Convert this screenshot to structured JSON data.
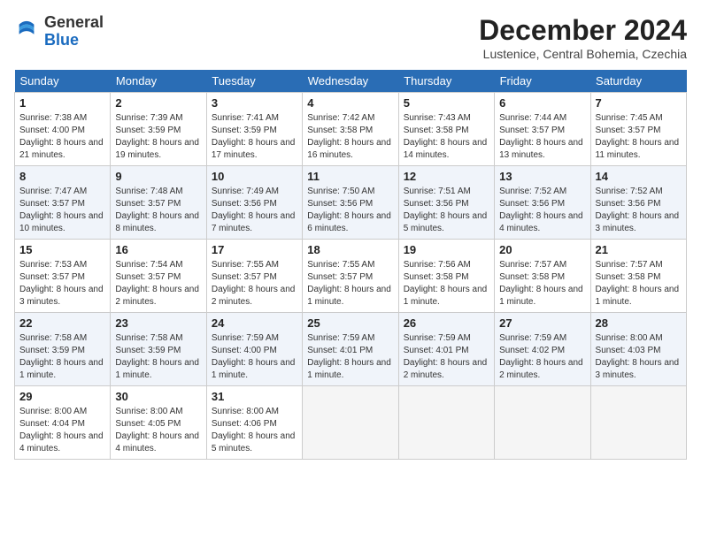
{
  "logo": {
    "general": "General",
    "blue": "Blue"
  },
  "title": "December 2024",
  "location": "Lustenice, Central Bohemia, Czechia",
  "days_of_week": [
    "Sunday",
    "Monday",
    "Tuesday",
    "Wednesday",
    "Thursday",
    "Friday",
    "Saturday"
  ],
  "weeks": [
    [
      {
        "day": 1,
        "sunrise": "7:38 AM",
        "sunset": "4:00 PM",
        "daylight": "8 hours and 21 minutes."
      },
      {
        "day": 2,
        "sunrise": "7:39 AM",
        "sunset": "3:59 PM",
        "daylight": "8 hours and 19 minutes."
      },
      {
        "day": 3,
        "sunrise": "7:41 AM",
        "sunset": "3:59 PM",
        "daylight": "8 hours and 17 minutes."
      },
      {
        "day": 4,
        "sunrise": "7:42 AM",
        "sunset": "3:58 PM",
        "daylight": "8 hours and 16 minutes."
      },
      {
        "day": 5,
        "sunrise": "7:43 AM",
        "sunset": "3:58 PM",
        "daylight": "8 hours and 14 minutes."
      },
      {
        "day": 6,
        "sunrise": "7:44 AM",
        "sunset": "3:57 PM",
        "daylight": "8 hours and 13 minutes."
      },
      {
        "day": 7,
        "sunrise": "7:45 AM",
        "sunset": "3:57 PM",
        "daylight": "8 hours and 11 minutes."
      }
    ],
    [
      {
        "day": 8,
        "sunrise": "7:47 AM",
        "sunset": "3:57 PM",
        "daylight": "8 hours and 10 minutes."
      },
      {
        "day": 9,
        "sunrise": "7:48 AM",
        "sunset": "3:57 PM",
        "daylight": "8 hours and 8 minutes."
      },
      {
        "day": 10,
        "sunrise": "7:49 AM",
        "sunset": "3:56 PM",
        "daylight": "8 hours and 7 minutes."
      },
      {
        "day": 11,
        "sunrise": "7:50 AM",
        "sunset": "3:56 PM",
        "daylight": "8 hours and 6 minutes."
      },
      {
        "day": 12,
        "sunrise": "7:51 AM",
        "sunset": "3:56 PM",
        "daylight": "8 hours and 5 minutes."
      },
      {
        "day": 13,
        "sunrise": "7:52 AM",
        "sunset": "3:56 PM",
        "daylight": "8 hours and 4 minutes."
      },
      {
        "day": 14,
        "sunrise": "7:52 AM",
        "sunset": "3:56 PM",
        "daylight": "8 hours and 3 minutes."
      }
    ],
    [
      {
        "day": 15,
        "sunrise": "7:53 AM",
        "sunset": "3:57 PM",
        "daylight": "8 hours and 3 minutes."
      },
      {
        "day": 16,
        "sunrise": "7:54 AM",
        "sunset": "3:57 PM",
        "daylight": "8 hours and 2 minutes."
      },
      {
        "day": 17,
        "sunrise": "7:55 AM",
        "sunset": "3:57 PM",
        "daylight": "8 hours and 2 minutes."
      },
      {
        "day": 18,
        "sunrise": "7:55 AM",
        "sunset": "3:57 PM",
        "daylight": "8 hours and 1 minute."
      },
      {
        "day": 19,
        "sunrise": "7:56 AM",
        "sunset": "3:58 PM",
        "daylight": "8 hours and 1 minute."
      },
      {
        "day": 20,
        "sunrise": "7:57 AM",
        "sunset": "3:58 PM",
        "daylight": "8 hours and 1 minute."
      },
      {
        "day": 21,
        "sunrise": "7:57 AM",
        "sunset": "3:58 PM",
        "daylight": "8 hours and 1 minute."
      }
    ],
    [
      {
        "day": 22,
        "sunrise": "7:58 AM",
        "sunset": "3:59 PM",
        "daylight": "8 hours and 1 minute."
      },
      {
        "day": 23,
        "sunrise": "7:58 AM",
        "sunset": "3:59 PM",
        "daylight": "8 hours and 1 minute."
      },
      {
        "day": 24,
        "sunrise": "7:59 AM",
        "sunset": "4:00 PM",
        "daylight": "8 hours and 1 minute."
      },
      {
        "day": 25,
        "sunrise": "7:59 AM",
        "sunset": "4:01 PM",
        "daylight": "8 hours and 1 minute."
      },
      {
        "day": 26,
        "sunrise": "7:59 AM",
        "sunset": "4:01 PM",
        "daylight": "8 hours and 2 minutes."
      },
      {
        "day": 27,
        "sunrise": "7:59 AM",
        "sunset": "4:02 PM",
        "daylight": "8 hours and 2 minutes."
      },
      {
        "day": 28,
        "sunrise": "8:00 AM",
        "sunset": "4:03 PM",
        "daylight": "8 hours and 3 minutes."
      }
    ],
    [
      {
        "day": 29,
        "sunrise": "8:00 AM",
        "sunset": "4:04 PM",
        "daylight": "8 hours and 4 minutes."
      },
      {
        "day": 30,
        "sunrise": "8:00 AM",
        "sunset": "4:05 PM",
        "daylight": "8 hours and 4 minutes."
      },
      {
        "day": 31,
        "sunrise": "8:00 AM",
        "sunset": "4:06 PM",
        "daylight": "8 hours and 5 minutes."
      },
      null,
      null,
      null,
      null
    ]
  ]
}
